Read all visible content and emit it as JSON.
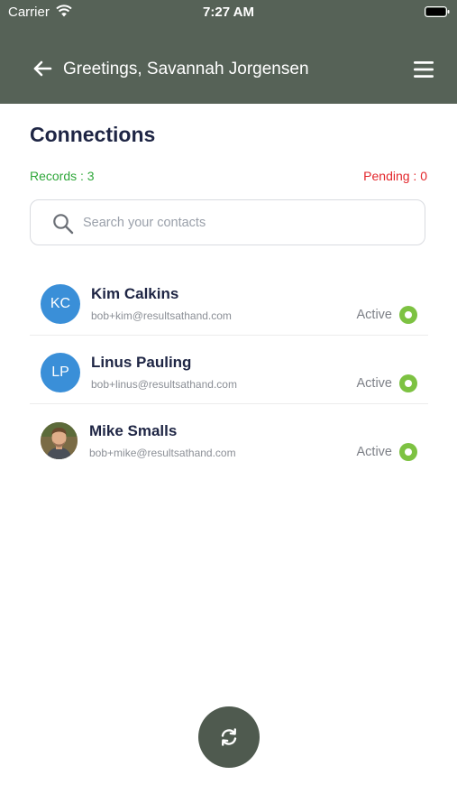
{
  "status_bar": {
    "carrier": "Carrier",
    "time": "7:27 AM"
  },
  "header": {
    "title": "Greetings, Savannah Jorgensen",
    "back_icon": "back-arrow-icon",
    "menu_icon": "hamburger-menu-icon",
    "background_color": "#566257"
  },
  "main": {
    "title": "Connections",
    "records_text": "Records : 3",
    "pending_text": "Pending : 0",
    "records_color": "#2fa73a",
    "pending_color": "#e3262b"
  },
  "search": {
    "placeholder": "Search your contacts",
    "value": ""
  },
  "contacts": [
    {
      "name": "Kim Calkins",
      "email": "bob+kim@resultsathand.com",
      "initials": "KC",
      "status": "Active"
    },
    {
      "name": "Linus Pauling",
      "email": "bob+linus@resultsathand.com",
      "initials": "LP",
      "status": "Active"
    },
    {
      "name": "Mike Smalls",
      "email": "bob+mike@resultsathand.com",
      "initials": "",
      "status": "Active"
    }
  ],
  "colors": {
    "accent_blue": "#3a8fd8",
    "active_green": "#7dc242",
    "fab_background": "#4f5a4f"
  },
  "fab": {
    "icon": "refresh-icon"
  }
}
